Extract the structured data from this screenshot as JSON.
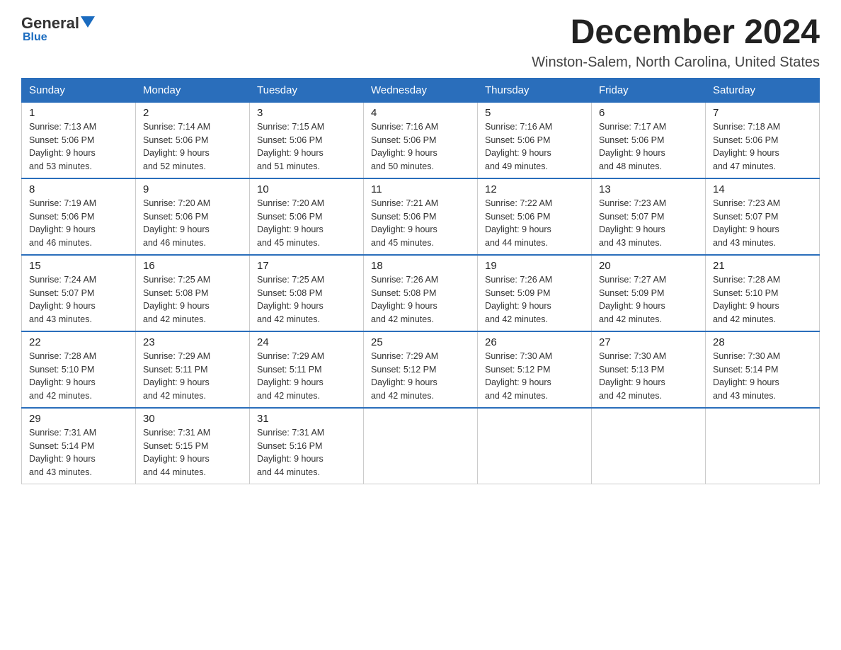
{
  "logo": {
    "general": "General",
    "triangle": "",
    "blue": "Blue"
  },
  "title": "December 2024",
  "subtitle": "Winston-Salem, North Carolina, United States",
  "days_of_week": [
    "Sunday",
    "Monday",
    "Tuesday",
    "Wednesday",
    "Thursday",
    "Friday",
    "Saturday"
  ],
  "weeks": [
    [
      {
        "day": "1",
        "sunrise": "7:13 AM",
        "sunset": "5:06 PM",
        "daylight": "9 hours and 53 minutes."
      },
      {
        "day": "2",
        "sunrise": "7:14 AM",
        "sunset": "5:06 PM",
        "daylight": "9 hours and 52 minutes."
      },
      {
        "day": "3",
        "sunrise": "7:15 AM",
        "sunset": "5:06 PM",
        "daylight": "9 hours and 51 minutes."
      },
      {
        "day": "4",
        "sunrise": "7:16 AM",
        "sunset": "5:06 PM",
        "daylight": "9 hours and 50 minutes."
      },
      {
        "day": "5",
        "sunrise": "7:16 AM",
        "sunset": "5:06 PM",
        "daylight": "9 hours and 49 minutes."
      },
      {
        "day": "6",
        "sunrise": "7:17 AM",
        "sunset": "5:06 PM",
        "daylight": "9 hours and 48 minutes."
      },
      {
        "day": "7",
        "sunrise": "7:18 AM",
        "sunset": "5:06 PM",
        "daylight": "9 hours and 47 minutes."
      }
    ],
    [
      {
        "day": "8",
        "sunrise": "7:19 AM",
        "sunset": "5:06 PM",
        "daylight": "9 hours and 46 minutes."
      },
      {
        "day": "9",
        "sunrise": "7:20 AM",
        "sunset": "5:06 PM",
        "daylight": "9 hours and 46 minutes."
      },
      {
        "day": "10",
        "sunrise": "7:20 AM",
        "sunset": "5:06 PM",
        "daylight": "9 hours and 45 minutes."
      },
      {
        "day": "11",
        "sunrise": "7:21 AM",
        "sunset": "5:06 PM",
        "daylight": "9 hours and 45 minutes."
      },
      {
        "day": "12",
        "sunrise": "7:22 AM",
        "sunset": "5:06 PM",
        "daylight": "9 hours and 44 minutes."
      },
      {
        "day": "13",
        "sunrise": "7:23 AM",
        "sunset": "5:07 PM",
        "daylight": "9 hours and 43 minutes."
      },
      {
        "day": "14",
        "sunrise": "7:23 AM",
        "sunset": "5:07 PM",
        "daylight": "9 hours and 43 minutes."
      }
    ],
    [
      {
        "day": "15",
        "sunrise": "7:24 AM",
        "sunset": "5:07 PM",
        "daylight": "9 hours and 43 minutes."
      },
      {
        "day": "16",
        "sunrise": "7:25 AM",
        "sunset": "5:08 PM",
        "daylight": "9 hours and 42 minutes."
      },
      {
        "day": "17",
        "sunrise": "7:25 AM",
        "sunset": "5:08 PM",
        "daylight": "9 hours and 42 minutes."
      },
      {
        "day": "18",
        "sunrise": "7:26 AM",
        "sunset": "5:08 PM",
        "daylight": "9 hours and 42 minutes."
      },
      {
        "day": "19",
        "sunrise": "7:26 AM",
        "sunset": "5:09 PM",
        "daylight": "9 hours and 42 minutes."
      },
      {
        "day": "20",
        "sunrise": "7:27 AM",
        "sunset": "5:09 PM",
        "daylight": "9 hours and 42 minutes."
      },
      {
        "day": "21",
        "sunrise": "7:28 AM",
        "sunset": "5:10 PM",
        "daylight": "9 hours and 42 minutes."
      }
    ],
    [
      {
        "day": "22",
        "sunrise": "7:28 AM",
        "sunset": "5:10 PM",
        "daylight": "9 hours and 42 minutes."
      },
      {
        "day": "23",
        "sunrise": "7:29 AM",
        "sunset": "5:11 PM",
        "daylight": "9 hours and 42 minutes."
      },
      {
        "day": "24",
        "sunrise": "7:29 AM",
        "sunset": "5:11 PM",
        "daylight": "9 hours and 42 minutes."
      },
      {
        "day": "25",
        "sunrise": "7:29 AM",
        "sunset": "5:12 PM",
        "daylight": "9 hours and 42 minutes."
      },
      {
        "day": "26",
        "sunrise": "7:30 AM",
        "sunset": "5:12 PM",
        "daylight": "9 hours and 42 minutes."
      },
      {
        "day": "27",
        "sunrise": "7:30 AM",
        "sunset": "5:13 PM",
        "daylight": "9 hours and 42 minutes."
      },
      {
        "day": "28",
        "sunrise": "7:30 AM",
        "sunset": "5:14 PM",
        "daylight": "9 hours and 43 minutes."
      }
    ],
    [
      {
        "day": "29",
        "sunrise": "7:31 AM",
        "sunset": "5:14 PM",
        "daylight": "9 hours and 43 minutes."
      },
      {
        "day": "30",
        "sunrise": "7:31 AM",
        "sunset": "5:15 PM",
        "daylight": "9 hours and 44 minutes."
      },
      {
        "day": "31",
        "sunrise": "7:31 AM",
        "sunset": "5:16 PM",
        "daylight": "9 hours and 44 minutes."
      },
      null,
      null,
      null,
      null
    ]
  ],
  "labels": {
    "sunrise": "Sunrise:",
    "sunset": "Sunset:",
    "daylight": "Daylight:"
  }
}
